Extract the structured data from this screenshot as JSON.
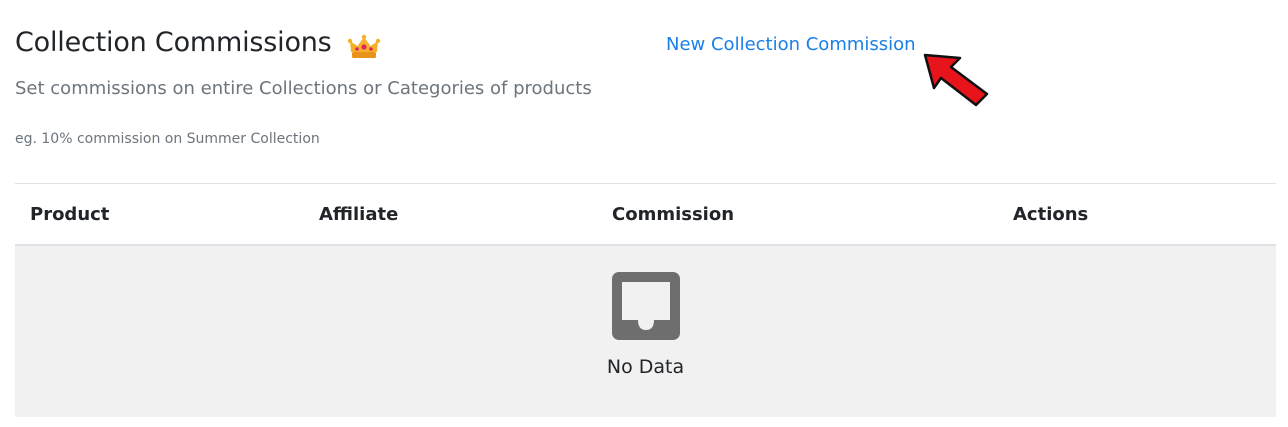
{
  "header": {
    "title": "Collection Commissions",
    "new_link": "New Collection Commission",
    "subtitle": "Set commissions on entire Collections or Categories of products",
    "example": "eg. 10% commission on Summer Collection",
    "premium_icon": "crown-icon",
    "pointer_icon": "red-arrow-icon"
  },
  "table": {
    "columns": [
      "Product",
      "Affiliate",
      "Commission",
      "Actions"
    ],
    "rows": [],
    "empty_text": "No Data",
    "empty_icon": "inbox-icon"
  },
  "colors": {
    "link": "#1a7fe6",
    "muted_text": "#6c757d",
    "empty_bg": "#f1f1f1",
    "arrow": "#e8141c",
    "crown": "#f5a623"
  }
}
